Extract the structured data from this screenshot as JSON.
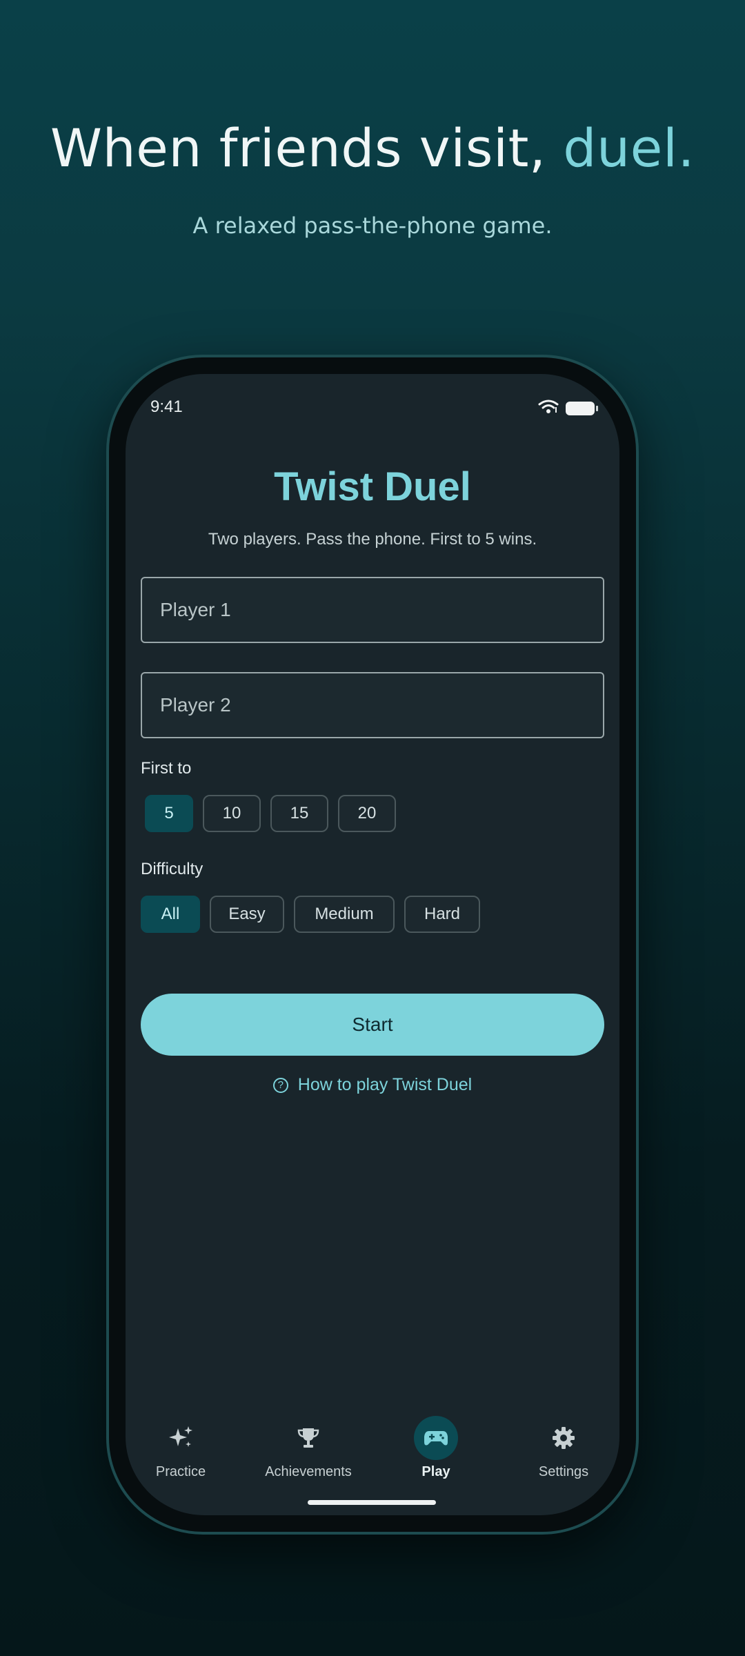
{
  "promo": {
    "headline_main": "When friends visit, ",
    "headline_accent": "duel.",
    "subline": "A relaxed pass-the-phone game."
  },
  "status_bar": {
    "time": "9:41",
    "icons": [
      "wifi-icon",
      "battery-icon"
    ]
  },
  "app": {
    "title": "Twist Duel",
    "subtitle": "Two players. Pass the phone. First to 5 wins.",
    "player1_placeholder": "Player 1",
    "player2_placeholder": "Player 2",
    "player1_value": "",
    "player2_value": "",
    "first_to": {
      "label": "First to",
      "options": [
        "5",
        "10",
        "15",
        "20"
      ],
      "selected": "5"
    },
    "difficulty": {
      "label": "Difficulty",
      "options": [
        "All",
        "Easy",
        "Medium",
        "Hard"
      ],
      "selected": "All"
    },
    "start_label": "Start",
    "how_to_label": "How to play Twist Duel"
  },
  "nav": {
    "items": [
      {
        "label": "Practice",
        "icon": "sparkles-icon",
        "active": false
      },
      {
        "label": "Achievements",
        "icon": "trophy-icon",
        "active": false
      },
      {
        "label": "Play",
        "icon": "gamepad-icon",
        "active": true
      },
      {
        "label": "Settings",
        "icon": "gear-icon",
        "active": false
      }
    ]
  },
  "colors": {
    "accent": "#7dd3db",
    "screen_bg": "#19252b",
    "chip_selected": "#0b4b54",
    "background_top": "#0a4048"
  }
}
